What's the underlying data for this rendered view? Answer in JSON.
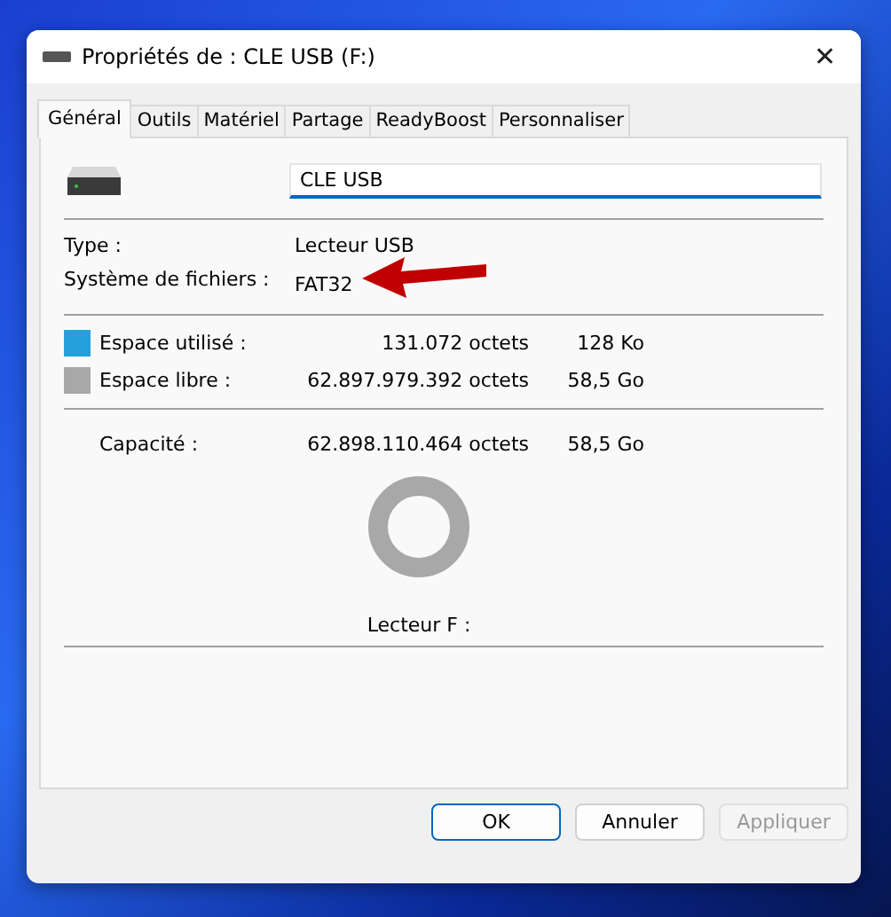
{
  "window": {
    "title": "Propriétés de : CLE USB (F:)",
    "close": "✕"
  },
  "tabs": [
    {
      "label": "Général",
      "selected": true
    },
    {
      "label": "Outils",
      "selected": false
    },
    {
      "label": "Matériel",
      "selected": false
    },
    {
      "label": "Partage",
      "selected": false
    },
    {
      "label": "ReadyBoost",
      "selected": false
    },
    {
      "label": "Personnaliser",
      "selected": false
    }
  ],
  "name_field": {
    "value": "CLE USB"
  },
  "info": [
    {
      "label": "Type :",
      "value": "Lecteur USB"
    },
    {
      "label": "Système de fichiers :",
      "value": "FAT32"
    }
  ],
  "space": [
    {
      "label": "Espace utilisé :",
      "bytes": "131.072 octets",
      "size": "128 Ko",
      "color": "#26a0da"
    },
    {
      "label": "Espace libre :",
      "bytes": "62.897.979.392 octets",
      "size": "58,5 Go",
      "color": "#a8a8a8"
    }
  ],
  "capacity": {
    "label": "Capacité :",
    "bytes": "62.898.110.464 octets",
    "size": "58,5 Go"
  },
  "drive_label": "Lecteur F :",
  "buttons": [
    {
      "label": "OK",
      "default": true,
      "disabled": false
    },
    {
      "label": "Annuler",
      "default": false,
      "disabled": false
    },
    {
      "label": "Appliquer",
      "default": false,
      "disabled": true
    }
  ]
}
